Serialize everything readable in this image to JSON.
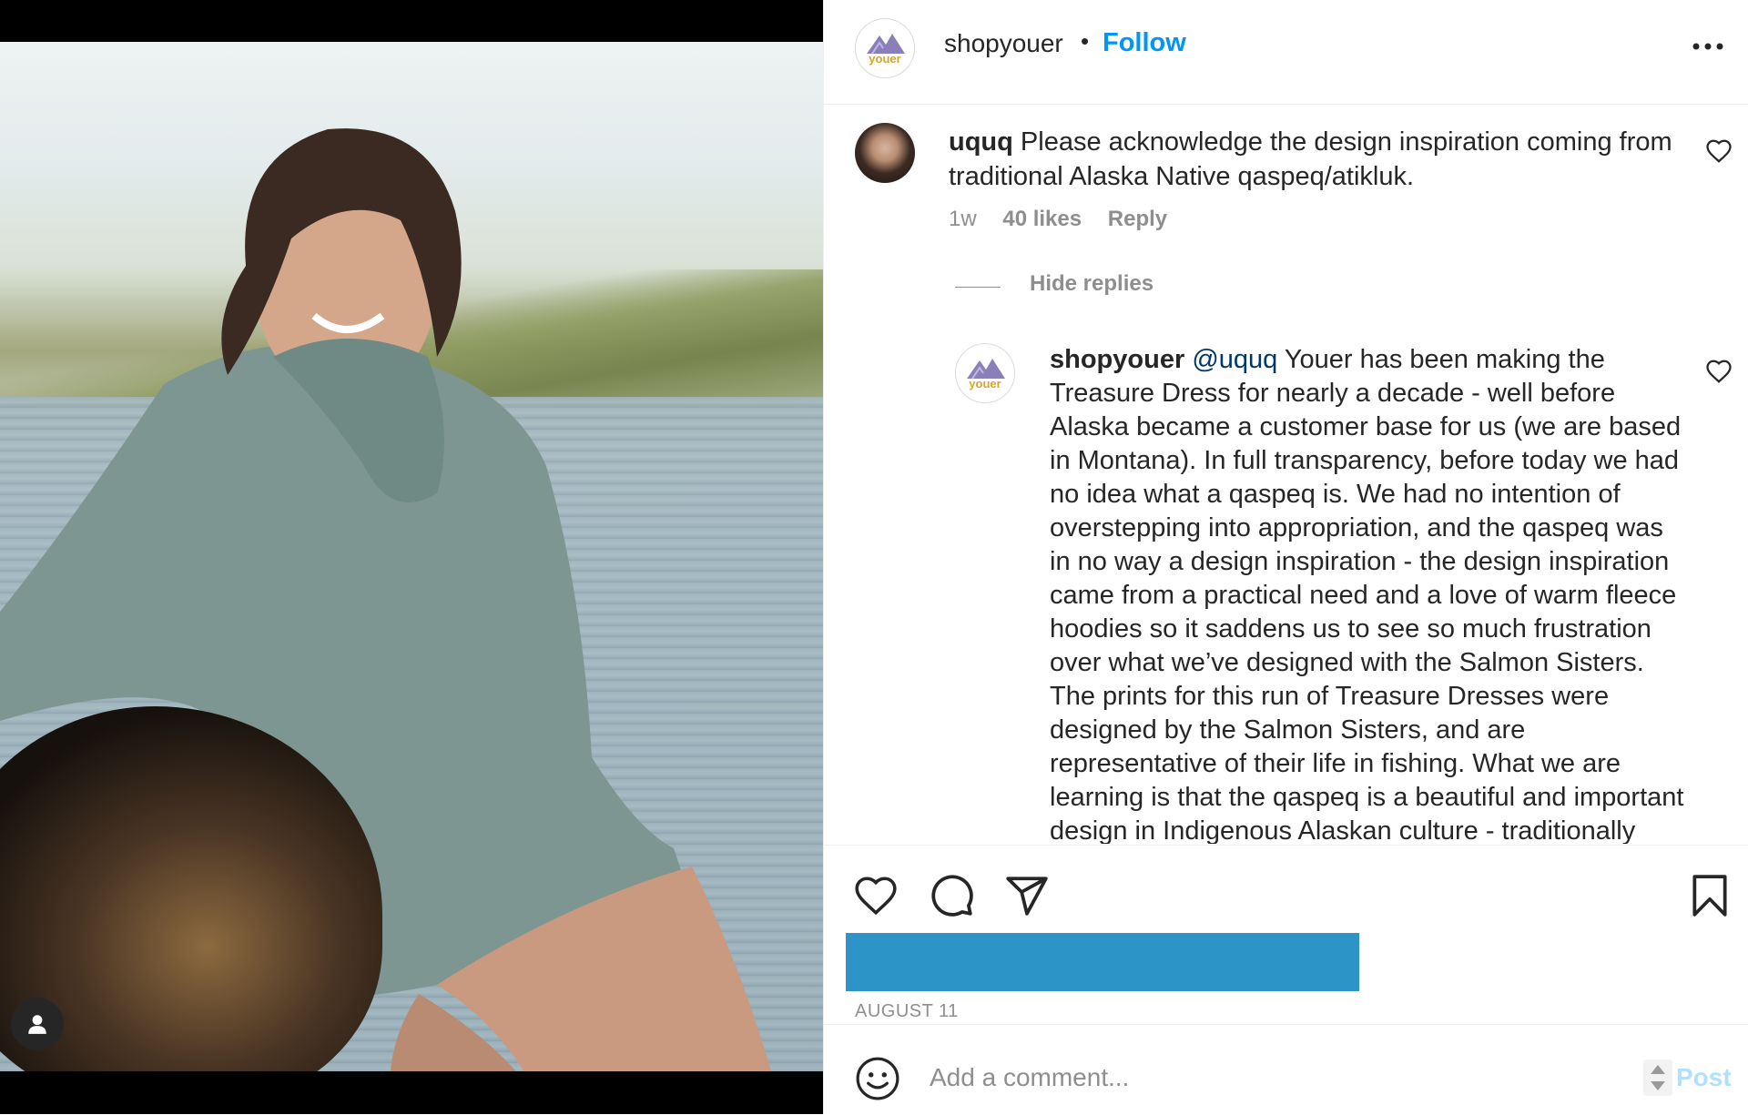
{
  "post": {
    "photo_alt_icon": "user-tag-icon",
    "header": {
      "username": "shopyouer",
      "separator": "•",
      "follow_label": "Follow",
      "avatar_text": "youer",
      "more_icon": "more-horizontal-icon"
    },
    "comments": [
      {
        "username": "uquq",
        "text": "Please acknowledge the design inspiration coming from traditional Alaska Native qaspeq/atikluk.",
        "time": "1w",
        "likes": "40 likes",
        "reply_label": "Reply",
        "hide_replies": "Hide replies",
        "replies": [
          {
            "username": "shopyouer",
            "mention": "@uquq",
            "avatar_text": "youer",
            "text": "Youer has been making the Treasure Dress for nearly a decade - well before Alaska became a customer base for us (we are based in Montana). In full transparency, before today we had no idea what a qaspeq is. We had no intention of overstepping into appropriation, and the qaspeq was in no way a design inspiration - the design inspiration came from a practical need and a love of warm fleece hoodies so it saddens us to see so much frustration over what we’ve designed with the Salmon Sisters. The prints for this run of Treasure Dresses were designed by the Salmon Sisters, and are representative of their life in fishing. What we are learning is that the qaspeq is a beautiful and important design in Indigenous Alaskan culture - traditionally made of animal skin as a"
          }
        ]
      }
    ],
    "actions": {
      "like_icon": "heart-icon",
      "comment_icon": "comment-icon",
      "share_icon": "send-icon",
      "save_icon": "bookmark-icon"
    },
    "date": "AUGUST 11",
    "add_comment": {
      "placeholder": "Add a comment...",
      "post_label": "Post",
      "emoji_icon": "emoji-icon"
    },
    "colors": {
      "follow": "#0095f6",
      "likes_bar": "#2c94c6",
      "post_disabled": "#b2dffc"
    }
  }
}
